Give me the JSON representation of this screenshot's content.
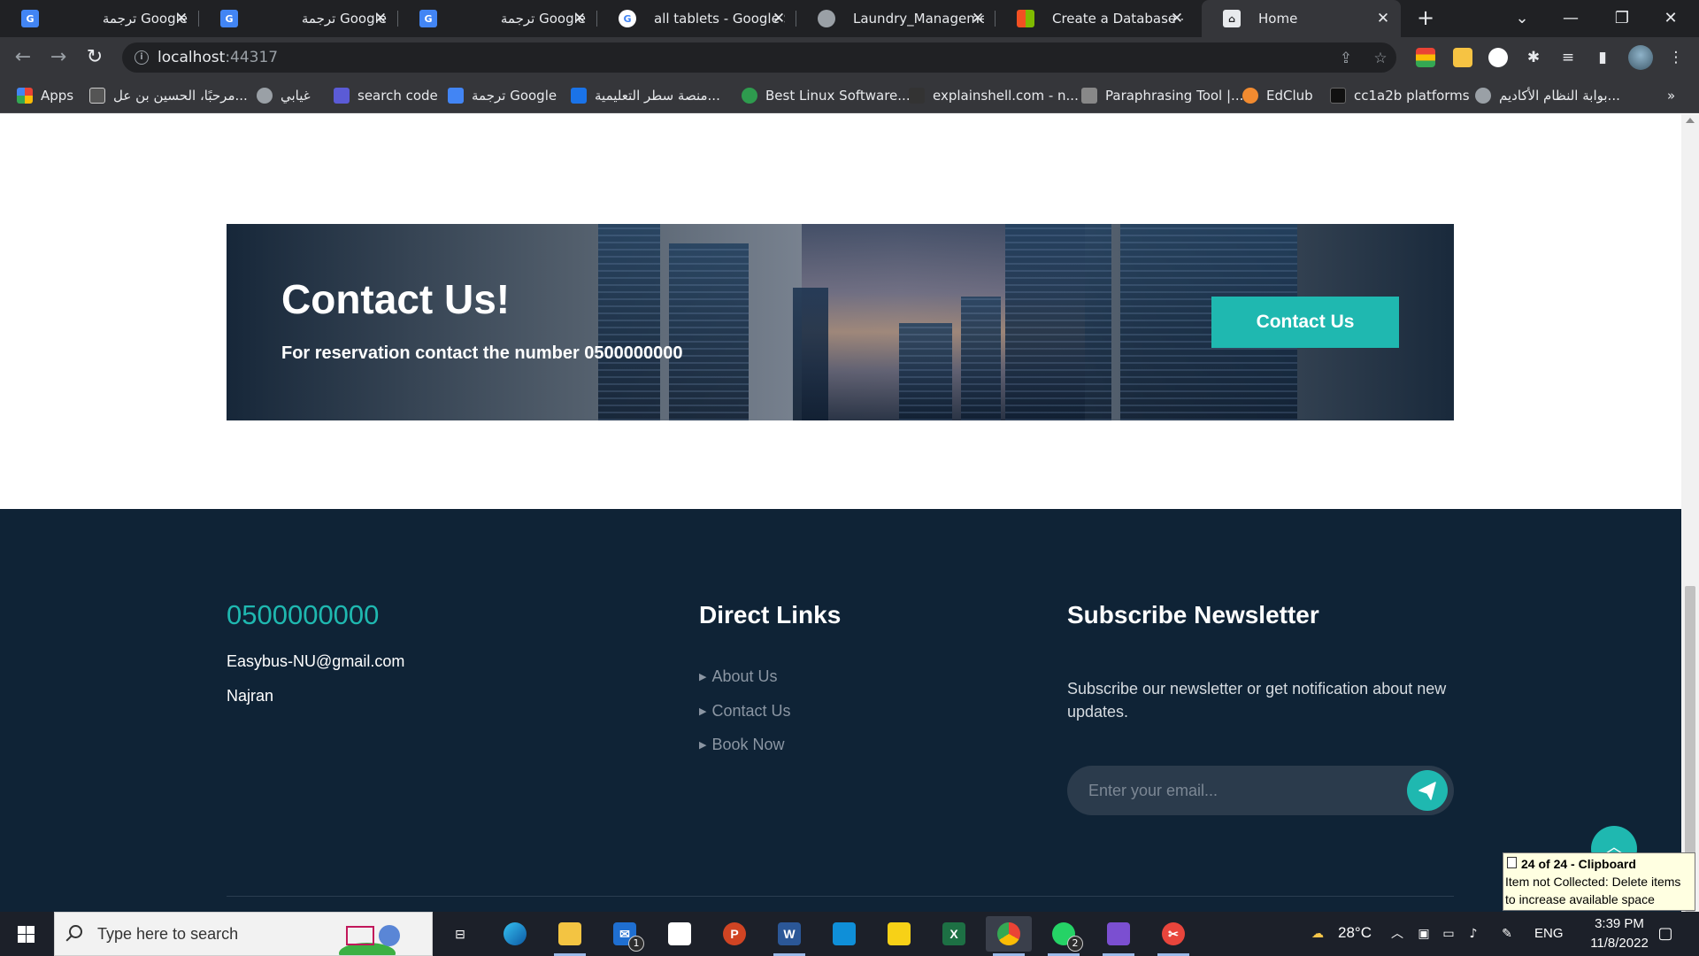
{
  "browser": {
    "tabs": [
      {
        "label": "ترجمة Google",
        "icon": "google-translate-icon"
      },
      {
        "label": "ترجمة Google",
        "icon": "google-translate-icon"
      },
      {
        "label": "ترجمة Google",
        "icon": "google-translate-icon"
      },
      {
        "label": "all tablets - Google Se",
        "icon": "google-icon"
      },
      {
        "label": "Laundry_Managemen",
        "icon": "globe-icon"
      },
      {
        "label": "Create a Database - S",
        "icon": "microsoft-icon"
      },
      {
        "label": "Home",
        "icon": "home-page-icon",
        "active": true
      }
    ],
    "url_host": "localhost",
    "url_port": ":44317",
    "bookmarks": [
      {
        "label": "Apps",
        "icon": "apps-grid-icon",
        "color": "#ea4335"
      },
      {
        "label": "مرحبًا، الحسين بن عل...",
        "icon": "bb-icon",
        "color": "#555555"
      },
      {
        "label": "غيابي",
        "icon": "globe-icon",
        "color": "#9aa0a6"
      },
      {
        "label": "search code",
        "icon": "search-code-icon",
        "color": "#5b5bd6"
      },
      {
        "label": "ترجمة Google",
        "icon": "google-translate-icon",
        "color": "#4285f4"
      },
      {
        "label": "منصة سطر التعليمية...",
        "icon": "platform-icon",
        "color": "#1a73e8"
      },
      {
        "label": "Best Linux Software...",
        "icon": "linux-icon",
        "color": "#2e9b4e"
      },
      {
        "label": "explainshell.com - n...",
        "icon": "shell-icon",
        "color": "#333333"
      },
      {
        "label": "Paraphrasing Tool |...",
        "icon": "feather-icon",
        "color": "#888888"
      },
      {
        "label": "EdClub",
        "icon": "edclub-icon",
        "color": "#f28b30"
      },
      {
        "label": "cc1a2b platforms",
        "icon": "platform-icon",
        "color": "#111111"
      },
      {
        "label": "بوابة النظام الأكاديم...",
        "icon": "globe-icon",
        "color": "#9aa0a6"
      }
    ],
    "bookmarks_overflow": "»"
  },
  "cta": {
    "title": "Contact Us!",
    "subtitle": "For reservation contact the number 0500000000",
    "button_label": "Contact Us"
  },
  "footer": {
    "phone": "0500000000",
    "email": "Easybus-NU@gmail.com",
    "city": "Najran",
    "links_heading": "Direct Links",
    "links": [
      "About Us",
      "Contact Us",
      "Book Now"
    ],
    "newsletter_heading": "Subscribe Newsletter",
    "newsletter_text": "Subscribe our newsletter or get notification about new updates.",
    "email_placeholder": "Enter your email..."
  },
  "clipboard_toast": {
    "title": "24 of 24 - Clipboard",
    "body": "Item not Collected: Delete items to increase available space"
  },
  "taskbar": {
    "search_placeholder": "Type here to search",
    "weather": "28°C",
    "language": "ENG",
    "time": "3:39 PM",
    "date": "11/8/2022",
    "mail_badge": "1",
    "whatsapp_badge": "2"
  },
  "colors": {
    "accent": "#1fb8b0",
    "footer_bg": "#0f2336",
    "cta_bg": "#0d1e31"
  }
}
